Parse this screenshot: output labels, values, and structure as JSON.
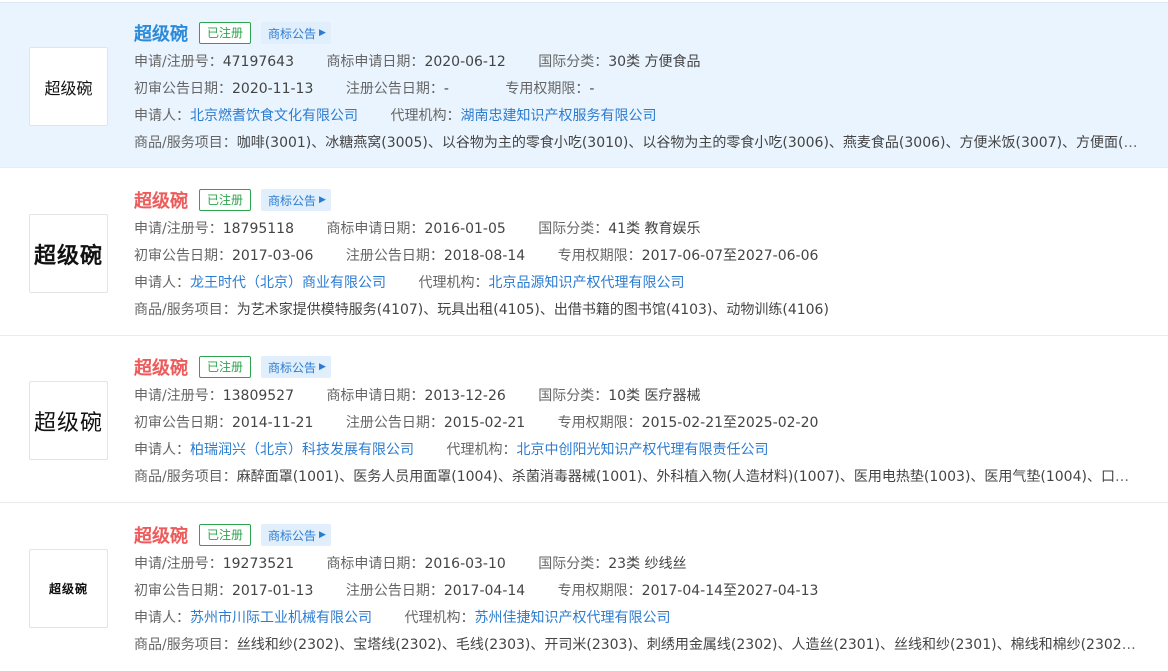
{
  "labels": {
    "app_no": "申请/注册号：",
    "apply_date": "商标申请日期：",
    "intl_class": "国际分类：",
    "first_notice": "初审公告日期：",
    "reg_notice": "注册公告日期：",
    "exclusive": "专用权期限：",
    "applicant": "申请人：",
    "agent": "代理机构：",
    "goods": "商品/服务项目："
  },
  "records": [
    {
      "name": "超级碗",
      "logo_text": "超级碗",
      "status": "已注册",
      "notice": "商标公告",
      "app_no": "47197643",
      "apply_date": "2020-06-12",
      "intl_class": "30类 方便食品",
      "first_notice": "2020-11-13",
      "reg_notice": "-",
      "exclusive": "-",
      "applicant": "北京燃耆饮食文化有限公司",
      "agent": "湖南忠建知识产权服务有限公司",
      "goods": "咖啡(3001)、冰糖燕窝(3005)、以谷物为主的零食小吃(3010)、以谷物为主的零食小吃(3006)、燕麦食品(3006)、方便米饭(3007)、方便面(300..."
    },
    {
      "name": "超级碗",
      "logo_text": "超级碗",
      "status": "已注册",
      "notice": "商标公告",
      "app_no": "18795118",
      "apply_date": "2016-01-05",
      "intl_class": "41类 教育娱乐",
      "first_notice": "2017-03-06",
      "reg_notice": "2018-08-14",
      "exclusive": "2017-06-07至2027-06-06",
      "applicant": "龙王时代（北京）商业有限公司",
      "agent": "北京品源知识产权代理有限公司",
      "goods": "为艺术家提供模特服务(4107)、玩具出租(4105)、出借书籍的图书馆(4103)、动物训练(4106)"
    },
    {
      "name": "超级碗",
      "logo_text": "超级碗",
      "status": "已注册",
      "notice": "商标公告",
      "app_no": "13809527",
      "apply_date": "2013-12-26",
      "intl_class": "10类 医疗器械",
      "first_notice": "2014-11-21",
      "reg_notice": "2015-02-21",
      "exclusive": "2015-02-21至2025-02-20",
      "applicant": "柏瑞润兴（北京）科技发展有限公司",
      "agent": "北京中创阳光知识产权代理有限责任公司",
      "goods": "麻醉面罩(1001)、医务人员用面罩(1004)、杀菌消毒器械(1001)、外科植入物(人造材料)(1007)、医用电热垫(1003)、医用气垫(1004)、口罩(10..."
    },
    {
      "name": "超级碗",
      "logo_text": "超级碗",
      "status": "已注册",
      "notice": "商标公告",
      "app_no": "19273521",
      "apply_date": "2016-03-10",
      "intl_class": "23类 纱线丝",
      "first_notice": "2017-01-13",
      "reg_notice": "2017-04-14",
      "exclusive": "2017-04-14至2027-04-13",
      "applicant": "苏州市川际工业机械有限公司",
      "agent": "苏州佳捷知识产权代理有限公司",
      "goods": "丝线和纱(2302)、宝塔线(2302)、毛线(2303)、开司米(2303)、刺绣用金属线(2302)、人造丝(2301)、丝线和纱(2301)、棉线和棉纱(2302)、棉..."
    }
  ],
  "colors": {
    "link": "#2c7cd0",
    "active_title": "#2c8ad9",
    "title_red": "#ee5b5b",
    "registered_green": "#2da44e",
    "active_row_bg": "#eaf4fe"
  },
  "icons": {
    "notice_arrow": "caret-right-icon"
  }
}
